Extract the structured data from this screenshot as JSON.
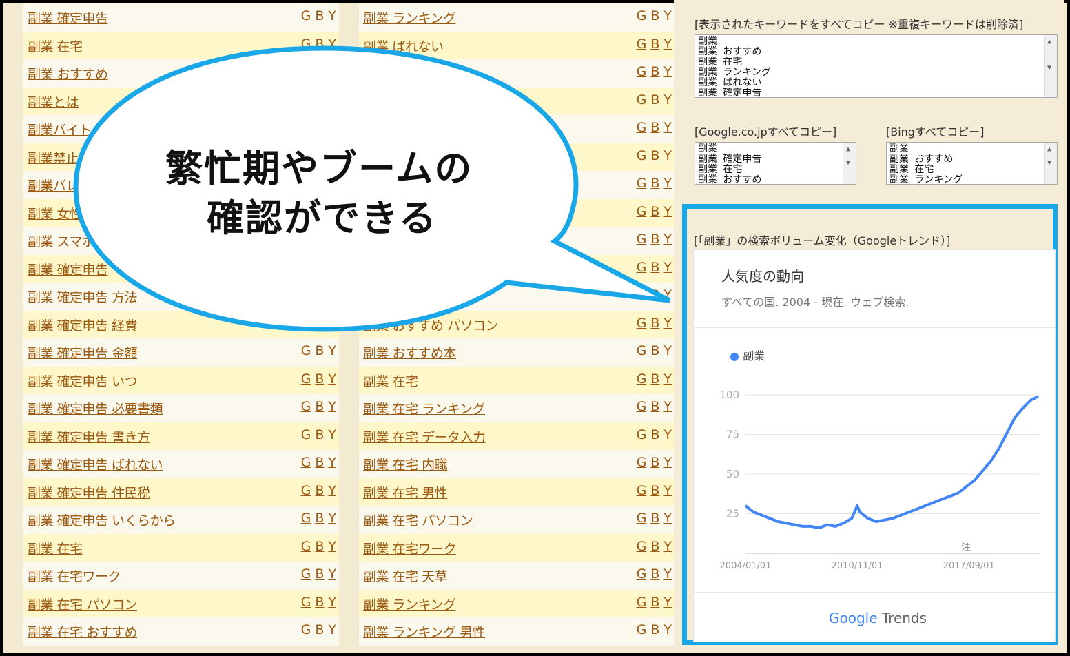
{
  "left_column": [
    "副業 確定申告",
    "副業 在宅",
    "副業 おすすめ",
    "副業とは",
    "副業バイト",
    "副業禁止",
    "副業バレ",
    "副業 女性",
    "副業 スマホ",
    "副業 確定申告",
    "副業 確定申告 方法",
    "副業 確定申告 経費",
    "副業 確定申告 金額",
    "副業 確定申告 いつ",
    "副業 確定申告 必要書類",
    "副業 確定申告 書き方",
    "副業 確定申告 ばれない",
    "副業 確定申告 住民税",
    "副業 確定申告 いくらから",
    "副業 在宅",
    "副業 在宅ワーク",
    "副業 在宅 パソコン",
    "副業 在宅 おすすめ"
  ],
  "right_column": [
    "副業 ランキング",
    "副業 ばれない",
    "",
    "",
    "",
    "",
    "",
    "",
    "",
    "",
    "",
    "副業 おすすめ パソコン",
    "副業 おすすめ本",
    "副業 在宅",
    "副業 在宅 ランキング",
    "副業 在宅 データ入力",
    "副業 在宅 内職",
    "副業 在宅 男性",
    "副業 在宅 パソコン",
    "副業 在宅ワーク",
    "副業 在宅 天草",
    "副業 ランキング",
    "副業 ランキング 男性"
  ],
  "gby": {
    "g": "G",
    "b": "B",
    "y": "Y"
  },
  "copy_all": {
    "label": "[表示されたキーワードをすべてコピー ※重複キーワードは削除済]",
    "lines": [
      "副業",
      "副業 おすすめ",
      "副業 在宅",
      "副業 ランキング",
      "副業 ばれない",
      "副業 確定申告"
    ]
  },
  "google_copy": {
    "label": "[Google.co.jpすべてコピー]",
    "lines": [
      "副業",
      "副業 確定申告",
      "副業 在宅",
      "副業 おすすめ"
    ]
  },
  "bing_copy": {
    "label": "[Bingすべてコピー]",
    "lines": [
      "副業",
      "副業 おすすめ",
      "副業 在宅",
      "副業 ランキング"
    ]
  },
  "trend": {
    "label": "[「副業」の検索ボリューム変化（Googleトレンド）]",
    "card_title": "人気度の動向",
    "card_subtitle": "すべての国. 2004 - 現在. ウェブ検索.",
    "footer_google": "Google",
    "footer_trends": "Trends",
    "note_glyph": "注"
  },
  "bubble": {
    "line1": "繁忙期やブームの",
    "line2": "確認ができる"
  },
  "colors": {
    "accent": "#1aa7e8",
    "link": "#9b5a12",
    "trend_line": "#4285f4"
  },
  "chart_data": {
    "type": "line",
    "series": [
      {
        "name": "副業"
      }
    ],
    "x_ticks": [
      "2004/01/01",
      "2010/11/01",
      "2017/09/01"
    ],
    "y_ticks": [
      100,
      75,
      50,
      25
    ],
    "ylim": [
      0,
      100
    ],
    "grid": true,
    "legend": "top-left",
    "points": [
      [
        "2004-01",
        30
      ],
      [
        "2004-07",
        26
      ],
      [
        "2005-01",
        24
      ],
      [
        "2005-07",
        22
      ],
      [
        "2006-01",
        20
      ],
      [
        "2006-07",
        19
      ],
      [
        "2007-01",
        18
      ],
      [
        "2007-07",
        17
      ],
      [
        "2008-01",
        17
      ],
      [
        "2008-07",
        16
      ],
      [
        "2009-01",
        18
      ],
      [
        "2009-07",
        17
      ],
      [
        "2010-01",
        19
      ],
      [
        "2010-07",
        22
      ],
      [
        "2010-11",
        30
      ],
      [
        "2011-01",
        26
      ],
      [
        "2011-07",
        22
      ],
      [
        "2012-01",
        20
      ],
      [
        "2012-07",
        21
      ],
      [
        "2013-01",
        22
      ],
      [
        "2013-07",
        24
      ],
      [
        "2014-01",
        26
      ],
      [
        "2014-07",
        28
      ],
      [
        "2015-01",
        30
      ],
      [
        "2015-07",
        32
      ],
      [
        "2016-01",
        34
      ],
      [
        "2016-07",
        36
      ],
      [
        "2017-01",
        38
      ],
      [
        "2017-07",
        42
      ],
      [
        "2018-01",
        46
      ],
      [
        "2018-07",
        52
      ],
      [
        "2019-01",
        58
      ],
      [
        "2019-07",
        66
      ],
      [
        "2020-01",
        76
      ],
      [
        "2020-07",
        86
      ],
      [
        "2021-01",
        92
      ],
      [
        "2021-07",
        97
      ],
      [
        "2021-12",
        99
      ]
    ]
  }
}
